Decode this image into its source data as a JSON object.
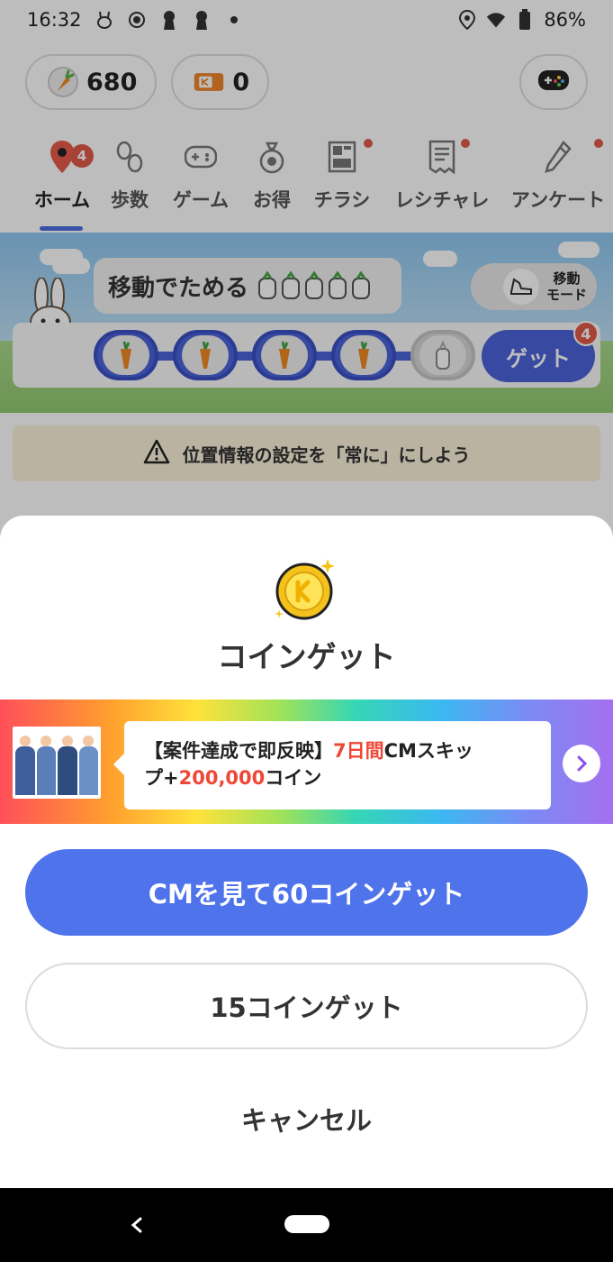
{
  "status_bar": {
    "time": "16:32",
    "battery": "86%",
    "left_icons": [
      "rabbit-notification-icon",
      "record-icon",
      "keyhole-icon",
      "keyhole-icon",
      "dot-icon"
    ],
    "right_icons": [
      "location-icon",
      "wifi-icon",
      "battery-icon"
    ]
  },
  "top_bar": {
    "carrot_count": "680",
    "ticket_count": "0"
  },
  "nav_tabs": [
    {
      "label": "ホーム",
      "icon": "pin-icon",
      "badge": "4",
      "active": true
    },
    {
      "label": "歩数",
      "icon": "footprints-icon"
    },
    {
      "label": "ゲーム",
      "icon": "gamepad-icon"
    },
    {
      "label": "お得",
      "icon": "money-bag-icon"
    },
    {
      "label": "チラシ",
      "icon": "flyer-icon",
      "dot": true
    },
    {
      "label": "レシチャレ",
      "icon": "receipt-icon",
      "dot": true
    },
    {
      "label": "アンケート",
      "icon": "pencil-icon",
      "dot": true
    }
  ],
  "move_panel": {
    "title": "移動でためる",
    "mode_label_line1": "移動",
    "mode_label_line2": "モード",
    "get_label": "ゲット",
    "get_badge": "4",
    "slots_filled": 4,
    "slots_total": 5
  },
  "location_banner": {
    "text": "位置情報の設定を「常に」にしよう"
  },
  "sheet": {
    "title": "コインゲット",
    "promo_line1_a": "【案件達成で即反映】",
    "promo_line1_b": "7日間",
    "promo_line1_c": "CMスキッ",
    "promo_line2_a": "プ+",
    "promo_line2_b": "200,000",
    "promo_line2_c": "コイン",
    "primary_button": "CMを見て60コインゲット",
    "secondary_button": "15コインゲット",
    "cancel_button": "キャンセル"
  },
  "colors": {
    "accent": "#4f73ea",
    "badge_red": "#e15b4a",
    "highlight_red": "#ef4736"
  }
}
